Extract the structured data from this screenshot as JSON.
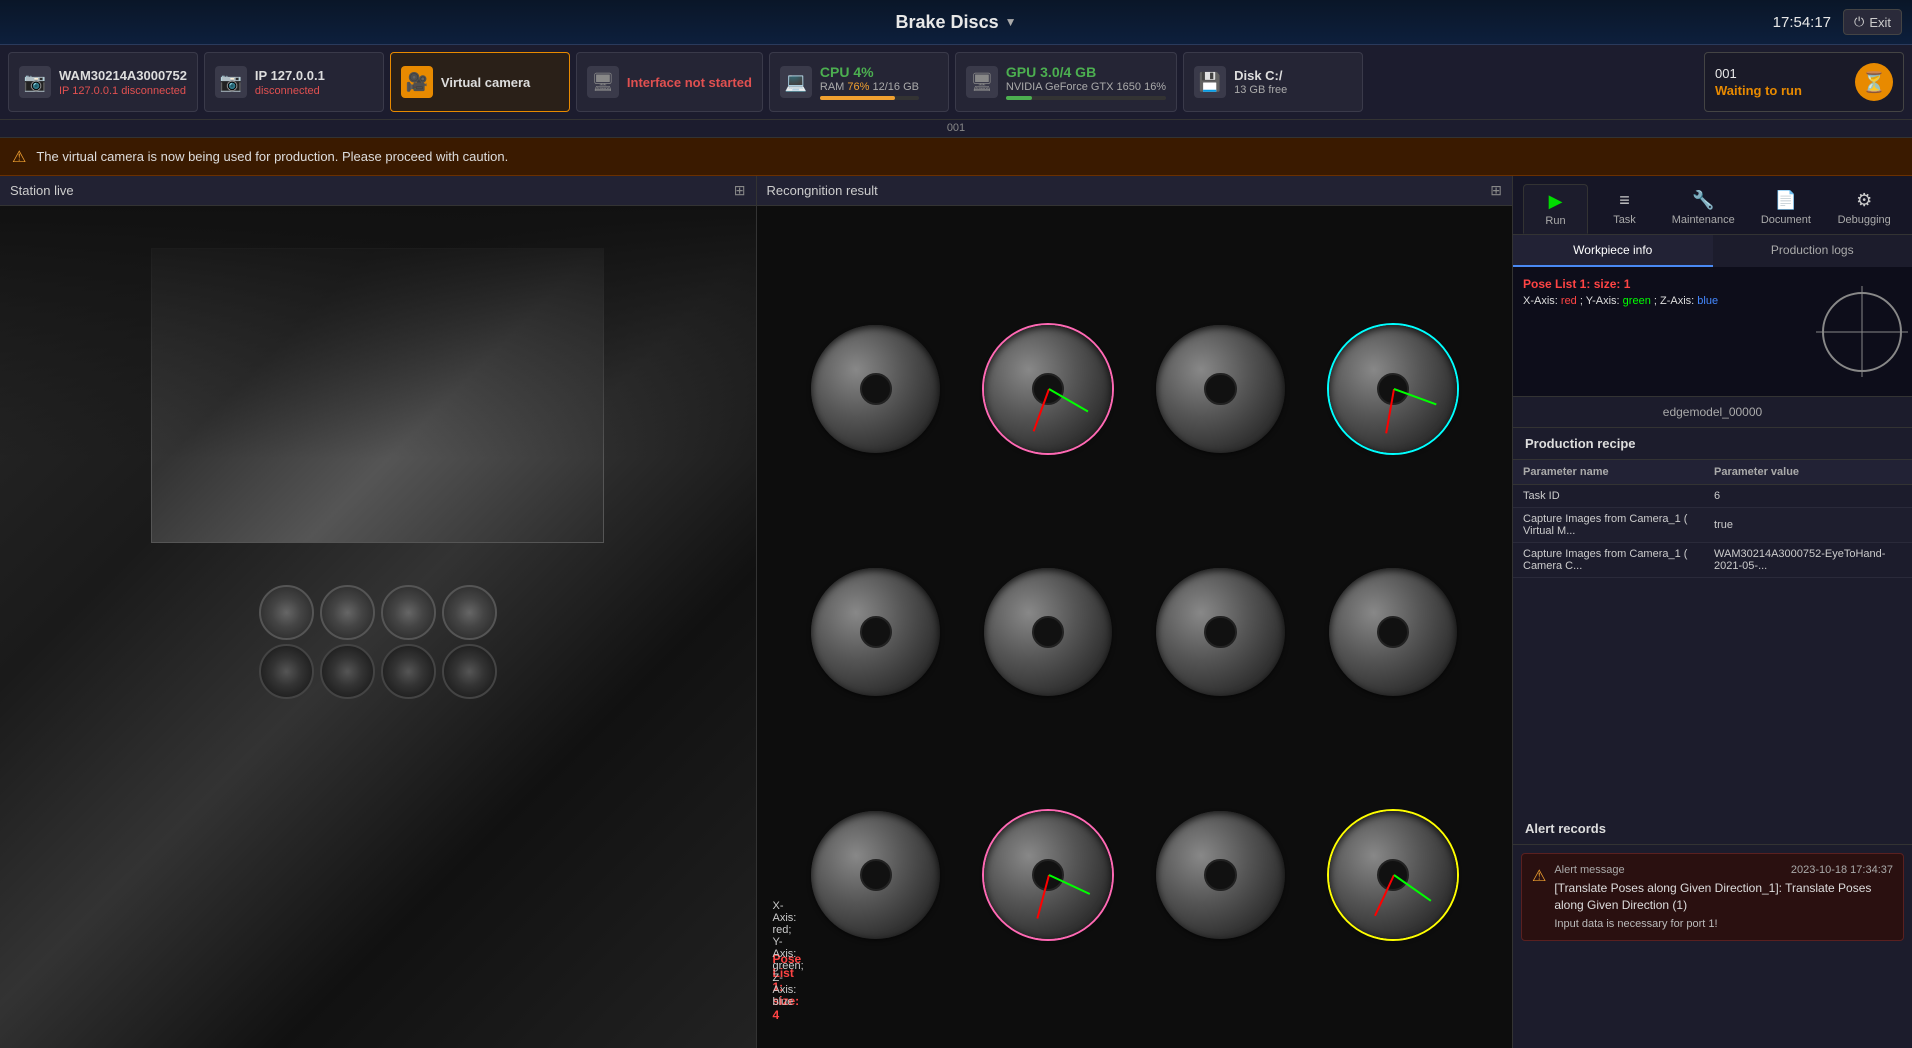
{
  "topbar": {
    "title": "Brake Discs",
    "dropdown_arrow": "▼",
    "time": "17:54:17",
    "exit_label": "Exit"
  },
  "statusbar": {
    "station_label": "001",
    "cards": [
      {
        "id": "cam1",
        "icon": "📷",
        "icon_class": "icon-camera",
        "title": "WAM30214A3000752",
        "sub": "IP 127.0.0.1 disconnected",
        "sub_class": "disconnected"
      },
      {
        "id": "cam2",
        "icon": "📷",
        "icon_class": "icon-camera",
        "title": "IP 127.0.0.1",
        "sub": "disconnected",
        "sub_class": "disconnected"
      },
      {
        "id": "vcam",
        "icon": "🎥",
        "icon_class": "icon-virtual",
        "title": "Virtual camera",
        "sub": "",
        "sub_class": ""
      },
      {
        "id": "iface",
        "icon": "🖥",
        "icon_class": "icon-interface",
        "title": "Interface not started",
        "sub": "",
        "sub_class": "not-started"
      },
      {
        "id": "cpu",
        "icon": "💻",
        "icon_class": "icon-cpu",
        "cpu_label": "CPU 4%",
        "ram_label": "RAM 76% 12/16 GB"
      },
      {
        "id": "gpu",
        "icon": "🖥",
        "icon_class": "icon-gpu",
        "gpu_label": "GPU 3.0/4 GB",
        "gpu_sub": "NVIDIA GeForce GTX 1650 16%"
      },
      {
        "id": "disk",
        "icon": "💾",
        "icon_class": "icon-disk",
        "disk_label": "Disk C:/",
        "disk_free": "13 GB free"
      }
    ],
    "waiting": {
      "num": "001",
      "label": "Waiting to run"
    }
  },
  "alert_bar": {
    "text": "The virtual camera is now being used for production. Please proceed with caution."
  },
  "left_panel": {
    "station_live_title": "Station live",
    "recognition_title": "Recongnition result"
  },
  "recognition": {
    "pose_label": "Pose List 1: size: 4",
    "axis_text": "X-Axis: red; Y-Axis: green; Z-Axis: blue"
  },
  "right_panel": {
    "nav_tabs": [
      {
        "id": "run",
        "icon": "▶",
        "label": "Run",
        "active": true,
        "icon_class": "run-icon"
      },
      {
        "id": "task",
        "icon": "⚙",
        "label": "Task",
        "active": false,
        "icon_class": ""
      },
      {
        "id": "maintenance",
        "icon": "🔧",
        "label": "Maintenance",
        "active": false,
        "icon_class": ""
      },
      {
        "id": "document",
        "icon": "📄",
        "label": "Document",
        "active": false,
        "icon_class": ""
      },
      {
        "id": "debugging",
        "icon": "🐛",
        "label": "Debugging",
        "active": false,
        "icon_class": ""
      }
    ],
    "sub_tabs": [
      {
        "id": "workpiece",
        "label": "Workpiece info",
        "active": true
      },
      {
        "id": "production",
        "label": "Production logs",
        "active": false
      }
    ],
    "pose_viz": {
      "list_label": "Pose List 1: size: 1",
      "axis_text": "X-Axis: red; Y-Axis: green; Z-Axis: blue"
    },
    "model_name": "edgemodel_00000",
    "recipe_title": "Production recipe",
    "recipe_headers": [
      "Parameter name",
      "Parameter value"
    ],
    "recipe_rows": [
      {
        "name": "Task ID",
        "value": "6"
      },
      {
        "name": "Capture Images from Camera_1 ( Virtual M...",
        "value": "true"
      },
      {
        "name": "Capture Images from Camera_1 ( Camera C...",
        "value": "WAM30214A3000752-EyeToHand-2021-05-..."
      }
    ],
    "alert_records_title": "Alert records",
    "alert_record": {
      "msg_label": "Alert message",
      "timestamp": "2023-10-18 17:34:37",
      "text": "[Translate Poses along Given Direction_1]: Translate Poses along Given Direction (1)",
      "detail": "Input data is necessary for port 1!"
    }
  }
}
